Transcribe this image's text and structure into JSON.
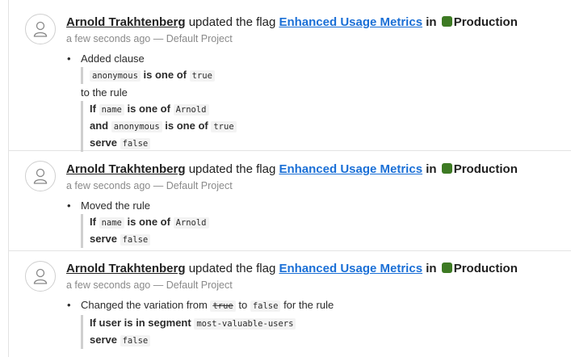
{
  "entries": [
    {
      "user": "Arnold Trakhtenberg",
      "action": "updated the flag",
      "flag": "Enhanced Usage Metrics",
      "in_word": "in",
      "environment": "Production",
      "environment_color": "#3d7a23",
      "time": "a few seconds ago",
      "separator": "—",
      "project": "Default Project",
      "change_label": "Added clause",
      "clause": {
        "attribute": "anonymous",
        "op": "is one of",
        "value": "true"
      },
      "to_rule_label": "to the rule",
      "rule": {
        "if_word": "If",
        "attribute": "name",
        "op": "is one of",
        "value": "Arnold",
        "and_word": "and",
        "attribute2": "anonymous",
        "op2": "is one of",
        "value2": "true",
        "serve_word": "serve",
        "serve_value": "false"
      }
    },
    {
      "user": "Arnold Trakhtenberg",
      "action": "updated the flag",
      "flag": "Enhanced Usage Metrics",
      "in_word": "in",
      "environment": "Production",
      "time": "a few seconds ago",
      "separator": "—",
      "project": "Default Project",
      "change_label": "Moved the rule",
      "rule": {
        "if_word": "If",
        "attribute": "name",
        "op": "is one of",
        "value": "Arnold",
        "serve_word": "serve",
        "serve_value": "false"
      }
    },
    {
      "user": "Arnold Trakhtenberg",
      "action": "updated the flag",
      "flag": "Enhanced Usage Metrics",
      "in_word": "in",
      "environment": "Production",
      "time": "a few seconds ago",
      "separator": "—",
      "project": "Default Project",
      "change_label": "Changed the variation from",
      "from_value": "true",
      "to_word": "to",
      "to_value": "false",
      "for_rule_label": "for the rule",
      "rule": {
        "if_text": "If user is in segment",
        "segment": "most-valuable-users",
        "serve_word": "serve",
        "serve_value": "false"
      }
    }
  ]
}
